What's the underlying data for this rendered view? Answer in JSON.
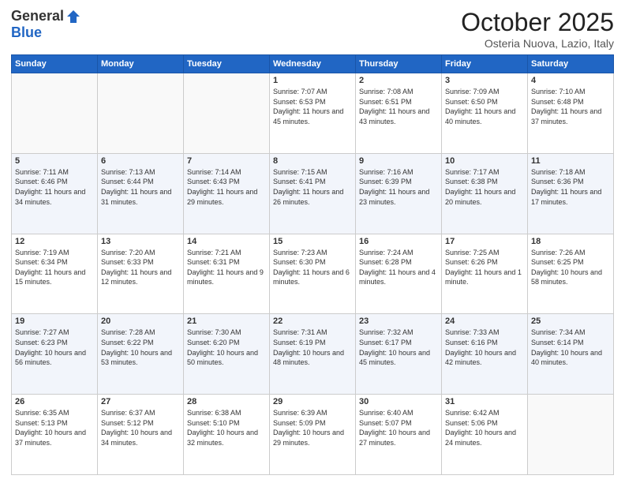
{
  "header": {
    "logo_general": "General",
    "logo_blue": "Blue",
    "month_title": "October 2025",
    "location": "Osteria Nuova, Lazio, Italy"
  },
  "days_of_week": [
    "Sunday",
    "Monday",
    "Tuesday",
    "Wednesday",
    "Thursday",
    "Friday",
    "Saturday"
  ],
  "weeks": [
    {
      "days": [
        {
          "number": "",
          "sunrise": "",
          "sunset": "",
          "daylight": ""
        },
        {
          "number": "",
          "sunrise": "",
          "sunset": "",
          "daylight": ""
        },
        {
          "number": "",
          "sunrise": "",
          "sunset": "",
          "daylight": ""
        },
        {
          "number": "1",
          "sunrise": "Sunrise: 7:07 AM",
          "sunset": "Sunset: 6:53 PM",
          "daylight": "Daylight: 11 hours and 45 minutes."
        },
        {
          "number": "2",
          "sunrise": "Sunrise: 7:08 AM",
          "sunset": "Sunset: 6:51 PM",
          "daylight": "Daylight: 11 hours and 43 minutes."
        },
        {
          "number": "3",
          "sunrise": "Sunrise: 7:09 AM",
          "sunset": "Sunset: 6:50 PM",
          "daylight": "Daylight: 11 hours and 40 minutes."
        },
        {
          "number": "4",
          "sunrise": "Sunrise: 7:10 AM",
          "sunset": "Sunset: 6:48 PM",
          "daylight": "Daylight: 11 hours and 37 minutes."
        }
      ]
    },
    {
      "days": [
        {
          "number": "5",
          "sunrise": "Sunrise: 7:11 AM",
          "sunset": "Sunset: 6:46 PM",
          "daylight": "Daylight: 11 hours and 34 minutes."
        },
        {
          "number": "6",
          "sunrise": "Sunrise: 7:13 AM",
          "sunset": "Sunset: 6:44 PM",
          "daylight": "Daylight: 11 hours and 31 minutes."
        },
        {
          "number": "7",
          "sunrise": "Sunrise: 7:14 AM",
          "sunset": "Sunset: 6:43 PM",
          "daylight": "Daylight: 11 hours and 29 minutes."
        },
        {
          "number": "8",
          "sunrise": "Sunrise: 7:15 AM",
          "sunset": "Sunset: 6:41 PM",
          "daylight": "Daylight: 11 hours and 26 minutes."
        },
        {
          "number": "9",
          "sunrise": "Sunrise: 7:16 AM",
          "sunset": "Sunset: 6:39 PM",
          "daylight": "Daylight: 11 hours and 23 minutes."
        },
        {
          "number": "10",
          "sunrise": "Sunrise: 7:17 AM",
          "sunset": "Sunset: 6:38 PM",
          "daylight": "Daylight: 11 hours and 20 minutes."
        },
        {
          "number": "11",
          "sunrise": "Sunrise: 7:18 AM",
          "sunset": "Sunset: 6:36 PM",
          "daylight": "Daylight: 11 hours and 17 minutes."
        }
      ]
    },
    {
      "days": [
        {
          "number": "12",
          "sunrise": "Sunrise: 7:19 AM",
          "sunset": "Sunset: 6:34 PM",
          "daylight": "Daylight: 11 hours and 15 minutes."
        },
        {
          "number": "13",
          "sunrise": "Sunrise: 7:20 AM",
          "sunset": "Sunset: 6:33 PM",
          "daylight": "Daylight: 11 hours and 12 minutes."
        },
        {
          "number": "14",
          "sunrise": "Sunrise: 7:21 AM",
          "sunset": "Sunset: 6:31 PM",
          "daylight": "Daylight: 11 hours and 9 minutes."
        },
        {
          "number": "15",
          "sunrise": "Sunrise: 7:23 AM",
          "sunset": "Sunset: 6:30 PM",
          "daylight": "Daylight: 11 hours and 6 minutes."
        },
        {
          "number": "16",
          "sunrise": "Sunrise: 7:24 AM",
          "sunset": "Sunset: 6:28 PM",
          "daylight": "Daylight: 11 hours and 4 minutes."
        },
        {
          "number": "17",
          "sunrise": "Sunrise: 7:25 AM",
          "sunset": "Sunset: 6:26 PM",
          "daylight": "Daylight: 11 hours and 1 minute."
        },
        {
          "number": "18",
          "sunrise": "Sunrise: 7:26 AM",
          "sunset": "Sunset: 6:25 PM",
          "daylight": "Daylight: 10 hours and 58 minutes."
        }
      ]
    },
    {
      "days": [
        {
          "number": "19",
          "sunrise": "Sunrise: 7:27 AM",
          "sunset": "Sunset: 6:23 PM",
          "daylight": "Daylight: 10 hours and 56 minutes."
        },
        {
          "number": "20",
          "sunrise": "Sunrise: 7:28 AM",
          "sunset": "Sunset: 6:22 PM",
          "daylight": "Daylight: 10 hours and 53 minutes."
        },
        {
          "number": "21",
          "sunrise": "Sunrise: 7:30 AM",
          "sunset": "Sunset: 6:20 PM",
          "daylight": "Daylight: 10 hours and 50 minutes."
        },
        {
          "number": "22",
          "sunrise": "Sunrise: 7:31 AM",
          "sunset": "Sunset: 6:19 PM",
          "daylight": "Daylight: 10 hours and 48 minutes."
        },
        {
          "number": "23",
          "sunrise": "Sunrise: 7:32 AM",
          "sunset": "Sunset: 6:17 PM",
          "daylight": "Daylight: 10 hours and 45 minutes."
        },
        {
          "number": "24",
          "sunrise": "Sunrise: 7:33 AM",
          "sunset": "Sunset: 6:16 PM",
          "daylight": "Daylight: 10 hours and 42 minutes."
        },
        {
          "number": "25",
          "sunrise": "Sunrise: 7:34 AM",
          "sunset": "Sunset: 6:14 PM",
          "daylight": "Daylight: 10 hours and 40 minutes."
        }
      ]
    },
    {
      "days": [
        {
          "number": "26",
          "sunrise": "Sunrise: 6:35 AM",
          "sunset": "Sunset: 5:13 PM",
          "daylight": "Daylight: 10 hours and 37 minutes."
        },
        {
          "number": "27",
          "sunrise": "Sunrise: 6:37 AM",
          "sunset": "Sunset: 5:12 PM",
          "daylight": "Daylight: 10 hours and 34 minutes."
        },
        {
          "number": "28",
          "sunrise": "Sunrise: 6:38 AM",
          "sunset": "Sunset: 5:10 PM",
          "daylight": "Daylight: 10 hours and 32 minutes."
        },
        {
          "number": "29",
          "sunrise": "Sunrise: 6:39 AM",
          "sunset": "Sunset: 5:09 PM",
          "daylight": "Daylight: 10 hours and 29 minutes."
        },
        {
          "number": "30",
          "sunrise": "Sunrise: 6:40 AM",
          "sunset": "Sunset: 5:07 PM",
          "daylight": "Daylight: 10 hours and 27 minutes."
        },
        {
          "number": "31",
          "sunrise": "Sunrise: 6:42 AM",
          "sunset": "Sunset: 5:06 PM",
          "daylight": "Daylight: 10 hours and 24 minutes."
        },
        {
          "number": "",
          "sunrise": "",
          "sunset": "",
          "daylight": ""
        }
      ]
    }
  ]
}
